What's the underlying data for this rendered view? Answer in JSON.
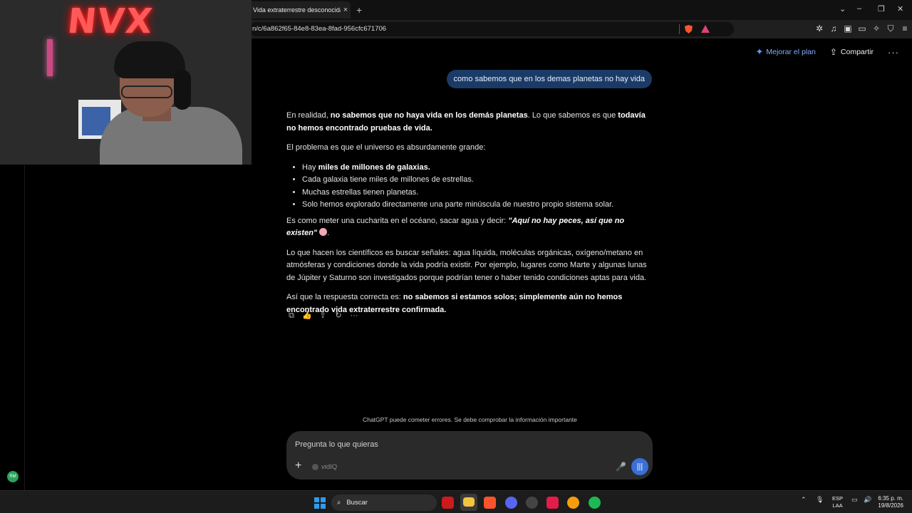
{
  "browser": {
    "tab_title": "Vida extraterrestre desconocida",
    "tab_close": "×",
    "new_tab": "+",
    "url": "n/c/6a862f65-84e8-83ea-8fad-956cfc671706",
    "window_controls": {
      "tabs_menu": "⌄",
      "minimize": "–",
      "restore": "❐",
      "close": "✕"
    }
  },
  "header": {
    "upgrade_label": "Mejorar el plan",
    "share_label": "Compartir",
    "more": "···"
  },
  "user_message": "como sabemos que en los demas planetas no hay vida",
  "answer": {
    "p1_a": "En realidad, ",
    "p1_b": "no sabemos que no haya vida en los demás planetas",
    "p1_c": ". Lo que sabemos es que ",
    "p1_d": "todavía no hemos encontrado pruebas de vida.",
    "p2": "El problema es que el universo es absurdamente grande:",
    "bullet1_a": "Hay ",
    "bullet1_b": "miles de millones de galaxias.",
    "bullet2": "Cada galaxia tiene miles de millones de estrellas.",
    "bullet3": "Muchas estrellas tienen planetas.",
    "bullet4": "Solo hemos explorado directamente una parte minúscula de nuestro propio sistema solar.",
    "p3_a": "Es como meter una cucharita en el océano, sacar agua y decir: ",
    "p3_b": "\"Aquí no hay peces, así que no existen\"",
    "p3_c": ".",
    "p4": "Lo que hacen los científicos es buscar señales: agua líquida, moléculas orgánicas, oxígeno/metano en atmósferas y condiciones donde la vida podría existir. Por ejemplo, lugares como Marte y algunas lunas de Júpiter y Saturno son investigados porque podrían tener o haber tenido condiciones aptas para vida.",
    "p5_a": "Así que la respuesta correcta es: ",
    "p5_b": "no sabemos si estamos solos; simplemente aún no hemos encontrado vida extraterrestre confirmada."
  },
  "disclaimer": "ChatGPT puede cometer errores. Se debe comprobar la información importante",
  "composer": {
    "placeholder": "Pregunta lo que quieras",
    "plus": "+",
    "tool_label": "vidIQ"
  },
  "webcam": {
    "neon_sign": "NVX"
  },
  "sidebar_avatar": "RM",
  "taskbar": {
    "search_label": "Buscar",
    "lang_top": "ESP",
    "lang_bottom": "LAA",
    "time": "6:35 p. m.",
    "date": "19/8/2026"
  },
  "colors": {
    "user_bubble": "#1b3b66",
    "upgrade_text": "#7fb0ff",
    "voice_button": "#3a6fd8",
    "neon": "#ff5a5a"
  }
}
